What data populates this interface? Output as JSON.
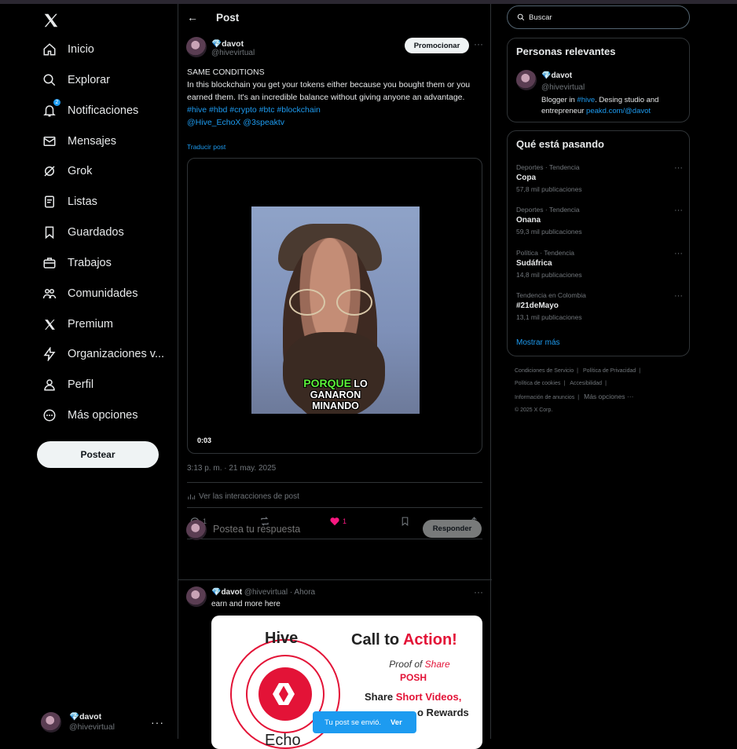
{
  "nav": {
    "items": [
      {
        "label": "Inicio",
        "icon": "home-icon"
      },
      {
        "label": "Explorar",
        "icon": "search-icon"
      },
      {
        "label": "Notificaciones",
        "icon": "bell-icon",
        "badge": "2"
      },
      {
        "label": "Mensajes",
        "icon": "mail-icon"
      },
      {
        "label": "Grok",
        "icon": "grok-icon"
      },
      {
        "label": "Listas",
        "icon": "list-icon"
      },
      {
        "label": "Guardados",
        "icon": "bookmark-icon"
      },
      {
        "label": "Trabajos",
        "icon": "briefcase-icon"
      },
      {
        "label": "Comunidades",
        "icon": "people-icon"
      },
      {
        "label": "Premium",
        "icon": "x-logo-icon"
      },
      {
        "label": "Organizaciones v...",
        "icon": "lightning-icon"
      },
      {
        "label": "Perfil",
        "icon": "person-icon"
      },
      {
        "label": "Más opciones",
        "icon": "more-circle-icon"
      }
    ],
    "post_button": "Postear",
    "account": {
      "name": "davot",
      "handle": "@hivevirtual"
    }
  },
  "header": {
    "title": "Post"
  },
  "post": {
    "name": "davot",
    "handle": "@hivevirtual",
    "promote_label": "Promocionar",
    "text_line1": "SAME CONDITIONS",
    "text_body": "In this blockchain you get your tokens either because you bought them or you earned them. It's an incredible balance without giving anyone an advantage.",
    "hashtags": "#hive #hbd #crypto #btc #blockchain",
    "mentions": "@Hive_EchoX @3speaktv",
    "translate": "Traducir post",
    "video_caption_hl": "PORQUE",
    "video_caption_1": "LO",
    "video_caption_2": "GANARON",
    "video_caption_3": "MINANDO",
    "video_time": "0:03",
    "date": "3:13 p. m. · 21 may. 2025",
    "insights": "Ver las interacciones de post",
    "replies": "1",
    "likes": "1"
  },
  "reply_box": {
    "placeholder": "Postea tu respuesta",
    "button": "Responder"
  },
  "reply": {
    "name": "davot",
    "handle": "@hivevirtual",
    "time": "Ahora",
    "text": "earn and more here",
    "image": {
      "hive": "Hive",
      "echo": "Echo",
      "cta_1": "Call to",
      "cta_2": "Action!",
      "proof_1": "Proof of",
      "proof_2": "Share",
      "posh": "POSH",
      "share_1": "Share",
      "share_2": "Short Videos,",
      "rewards": "o Rewards"
    }
  },
  "toast": {
    "text": "Tu post se envió.",
    "action": "Ver"
  },
  "search": {
    "placeholder": "Buscar"
  },
  "relevant": {
    "title": "Personas relevantes",
    "name": "davot",
    "handle": "@hivevirtual",
    "bio_1": "Blogger in",
    "bio_tag": "#hive",
    "bio_2": ". Desing studio and entrepreneur",
    "bio_link": "peakd.com/@davot"
  },
  "trends": {
    "title": "Qué está pasando",
    "items": [
      {
        "context": "Deportes · Tendencia",
        "name": "Copa",
        "count": "57,8 mil publicaciones"
      },
      {
        "context": "Deportes · Tendencia",
        "name": "Onana",
        "count": "59,3 mil publicaciones"
      },
      {
        "context": "Política · Tendencia",
        "name": "Sudáfrica",
        "count": "14,8 mil publicaciones"
      },
      {
        "context": "Tendencia en Colombia",
        "name": "#21deMayo",
        "count": "13,1 mil publicaciones"
      }
    ],
    "show_more": "Mostrar más"
  },
  "footer": {
    "links": [
      "Condiciones de Servicio",
      "Política de Privacidad",
      "Política de cookies",
      "Accesibilidad",
      "Información de anuncios"
    ],
    "more": "Más opciones ···",
    "copyright": "© 2025 X Corp."
  },
  "colors": {
    "accent": "#1d9bf0",
    "like": "#f91880",
    "hive_red": "#e31337"
  }
}
